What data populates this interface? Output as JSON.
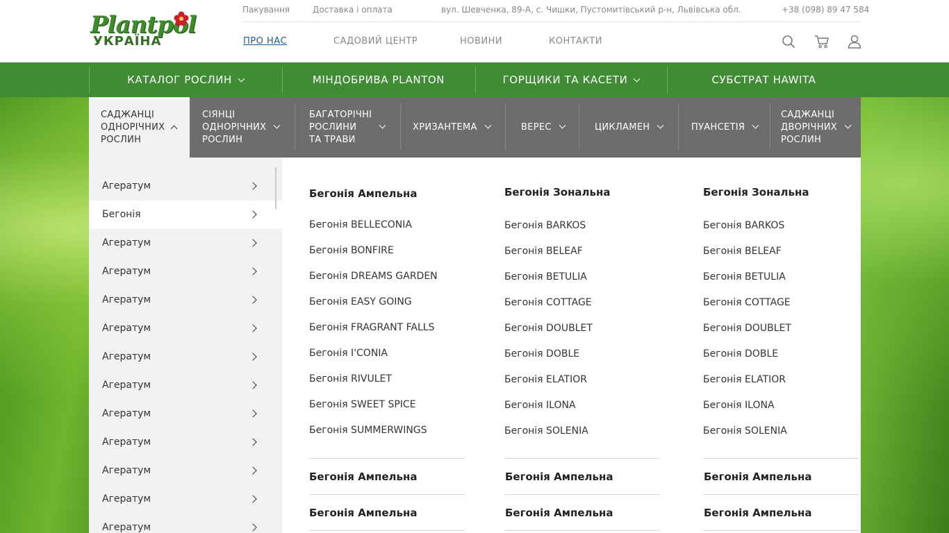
{
  "brand": {
    "name": "Plantpol",
    "sub": "УКРАЇНА"
  },
  "top_links": {
    "packaging": "Пакування",
    "delivery": "Доставка і оплата",
    "address": "вул. Шевченка, 89-А, с. Чишки, Пустомитівський р-н, Львівська обл.",
    "phone": "+38 (098) 89 47 584"
  },
  "main_nav": [
    "ПРО НАС",
    "САДОВИЙ ЦЕНТР",
    "НОВИНИ",
    "КОНТАКТИ"
  ],
  "icons": [
    "search-icon",
    "cart-icon",
    "user-icon"
  ],
  "categories": [
    "КАТАЛОГ РОСЛИН",
    "МІНДОБРИВА PLANTON",
    "ГОРЩИКИ ТА КАСЕТИ",
    "СУБСТРАТ HAWITA"
  ],
  "subcategories": [
    {
      "label": "САДЖАНЦІ\nОДНОРІЧНИХ\nРОСЛИН",
      "active": true
    },
    {
      "label": "СІЯНЦІ\nОДНОРІЧНИХ\nРОСЛИН"
    },
    {
      "label": "БАГАТОРІЧНІ\nРОСЛИНИ\nТА ТРАВИ"
    },
    {
      "label": "ХРИЗАНТЕМА"
    },
    {
      "label": "ВЕРЕС"
    },
    {
      "label": "ЦИКЛАМЕН"
    },
    {
      "label": "ПУАНСЕТІЯ"
    },
    {
      "label": "САДЖАНЦІ\nДВОРІЧНИХ\nРОСЛИН"
    }
  ],
  "left_menu": [
    "Агератум",
    "Бегонія",
    "Агератум",
    "Агератум",
    "Агератум",
    "Агератум",
    "Агератум",
    "Агератум",
    "Агератум",
    "Агератум",
    "Агератум",
    "Агератум",
    "Агератум"
  ],
  "columns": [
    {
      "title": "Бегонія Ампельна",
      "links": [
        "Бегонія BELLECONIA",
        "Бегонія BONFIRE",
        "Бегонія DREAMS GARDEN",
        "Бегонія EASY GOING",
        "Бегонія FRAGRANT FALLS",
        "Бегонія I'CONIA",
        "Бегонія RIVULET",
        "Бегонія SWEET SPICE",
        "Бегонія SUMMERWINGS"
      ],
      "groups": [
        "Бегонія Ампельна",
        "Бегонія Ампельна"
      ]
    },
    {
      "title": "Бегонія Зональна",
      "links": [
        "Бегонія BARKOS",
        "Бегонія BELEAF",
        "Бегонія BETULIA",
        "Бегонія COTTAGE",
        "Бегонія DOUBLET",
        "Бегонія DOBLE",
        "Бегонія ELATIOR",
        "Бегонія ILONA",
        "Бегонія SOLENIA"
      ],
      "groups": [
        "Бегонія Ампельна",
        "Бегонія Ампельна"
      ]
    },
    {
      "title": "Бегонія Зональна",
      "links": [
        "Бегонія BARKOS",
        "Бегонія BELEAF",
        "Бегонія BETULIA",
        "Бегонія COTTAGE",
        "Бегонія DOUBLET",
        "Бегонія DOBLE",
        "Бегонія ELATIOR",
        "Бегонія ILONA",
        "Бегонія SOLENIA"
      ],
      "groups": [
        "Бегонія Ампельна",
        "Бегонія Ампельна"
      ]
    }
  ]
}
